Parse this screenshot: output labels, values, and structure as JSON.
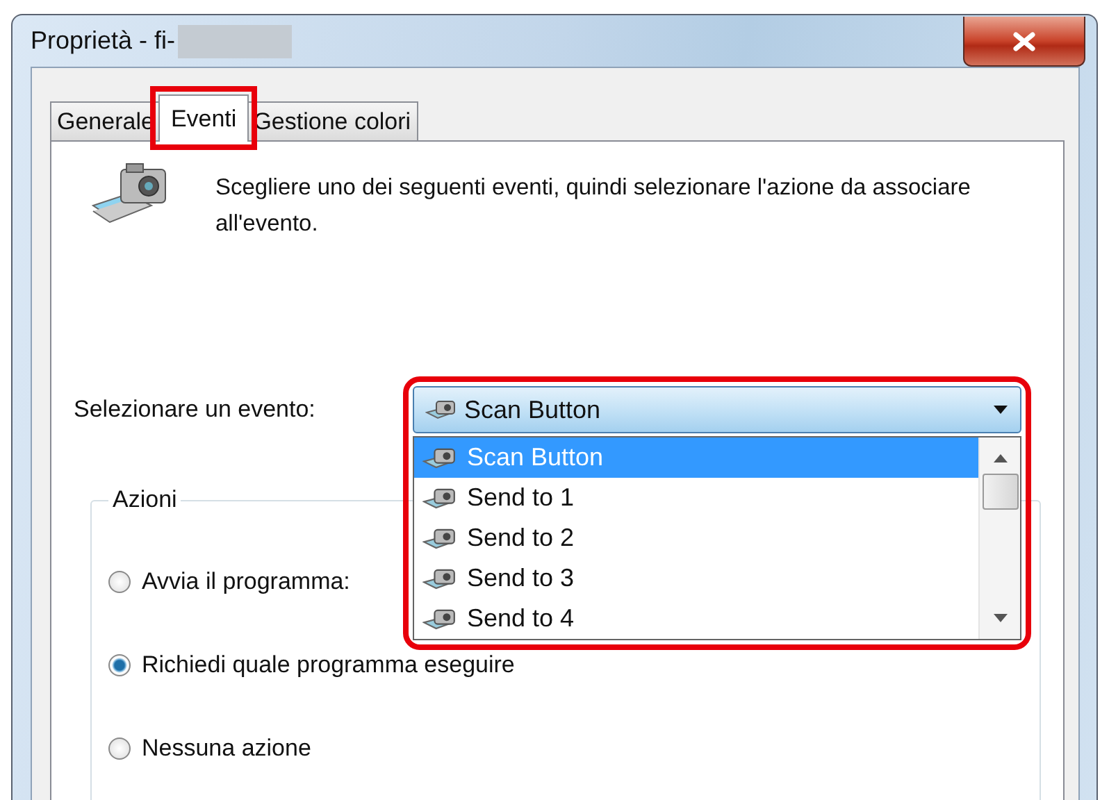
{
  "window": {
    "title": "Proprietà - fi-",
    "title_redacted": true
  },
  "tabs": [
    {
      "label": "Generale",
      "selected": false,
      "highlighted": false
    },
    {
      "label": "Eventi",
      "selected": true,
      "highlighted": true
    },
    {
      "label": "Gestione colori",
      "selected": false,
      "highlighted": false
    }
  ],
  "description": "Scegliere uno dei seguenti eventi, quindi selezionare l'azione da associare all'evento.",
  "event_select": {
    "label": "Selezionare un evento:",
    "value": "Scan Button",
    "expanded": true,
    "highlighted": true,
    "options": [
      {
        "label": "Scan Button",
        "selected": true
      },
      {
        "label": "Send to 1",
        "selected": false
      },
      {
        "label": "Send to 2",
        "selected": false
      },
      {
        "label": "Send to 3",
        "selected": false
      },
      {
        "label": "Send to 4",
        "selected": false
      }
    ]
  },
  "actions": {
    "title": "Azioni",
    "options": [
      {
        "label": "Avvia il programma:",
        "selected": false
      },
      {
        "label": "Richiedi quale programma eseguire",
        "selected": true
      },
      {
        "label": "Nessuna azione",
        "selected": false
      }
    ]
  }
}
